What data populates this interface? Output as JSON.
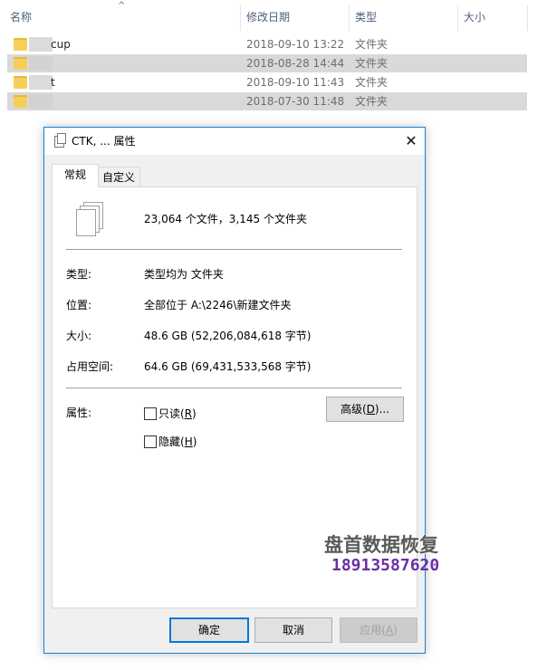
{
  "columns": {
    "name": "名称",
    "modified": "修改日期",
    "type": "类型",
    "size": "大小"
  },
  "rows": [
    {
      "name": "cup",
      "date": "2018-09-10 13:22",
      "type": "文件夹",
      "selected": false
    },
    {
      "name": "",
      "date": "2018-08-28 14:44",
      "type": "文件夹",
      "selected": true
    },
    {
      "name": "t",
      "date": "2018-09-10 11:43",
      "type": "文件夹",
      "selected": false
    },
    {
      "name": "",
      "date": "2018-07-30 11:48",
      "type": "文件夹",
      "selected": true
    }
  ],
  "dialog": {
    "title": "CTK, ... 属性",
    "tabs": [
      "常规",
      "自定义"
    ],
    "summary": "23,064 个文件，3,145 个文件夹",
    "type_label": "类型:",
    "type_value": "类型均为 文件夹",
    "location_label": "位置:",
    "location_value": "全部位于 A:\\2246\\新建文件夹",
    "size_label": "大小:",
    "size_value": "48.6 GB (52,206,084,618 字节)",
    "disk_label": "占用空间:",
    "disk_value": "64.6 GB (69,431,533,568 字节)",
    "attributes_label": "属性:",
    "readonly": {
      "text": "只读(",
      "key": "R",
      "end": ")",
      "checked": false
    },
    "hidden": {
      "text": "隐藏(",
      "key": "H",
      "end": ")",
      "checked": false
    },
    "advanced": {
      "text": "高级(",
      "key": "D",
      "end": ")..."
    },
    "ok": "确定",
    "cancel": "取消",
    "apply": {
      "text": "应用(",
      "key": "A",
      "end": ")"
    }
  },
  "watermark": {
    "line1": "盘首数据恢复",
    "line2": "18913587620"
  }
}
